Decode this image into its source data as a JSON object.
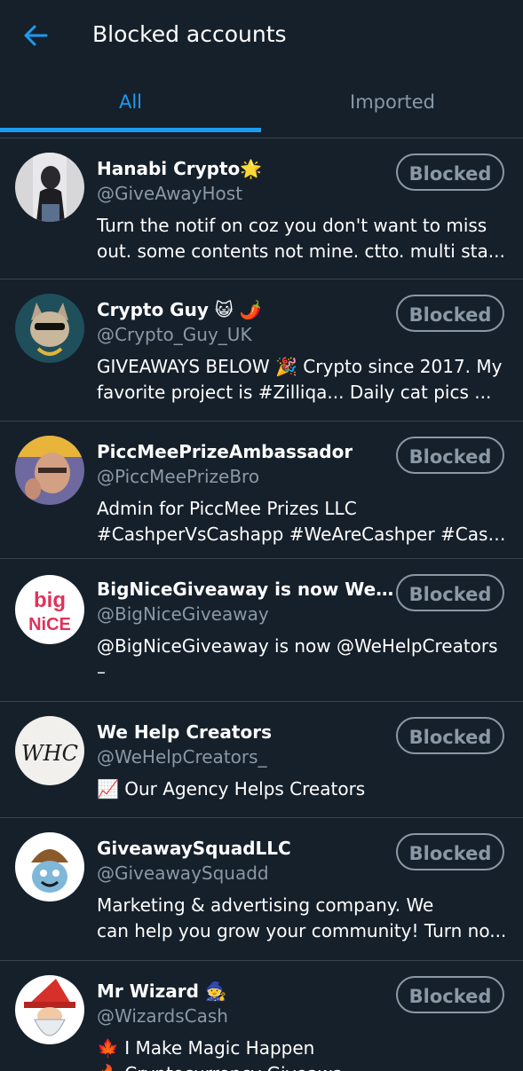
{
  "header": {
    "title": "Blocked accounts",
    "back_icon": "arrow-left-icon"
  },
  "tabs": [
    {
      "label": "All"
    },
    {
      "label": "Imported"
    }
  ],
  "colors": {
    "background": "#15202b",
    "accent": "#1d9bf0",
    "muted": "#8b98a5",
    "divider": "#38444d"
  },
  "accounts": [
    {
      "name": "Hanabi Crypto🌟",
      "handle": "@GiveAwayHost",
      "bio": [
        "Turn the notif on coz you don't want to miss",
        "out. some contents not mine. ctto. multi sta..."
      ],
      "button": "Blocked"
    },
    {
      "name": "Crypto Guy 😺 🌶️",
      "handle": "@Crypto_Guy_UK",
      "bio": [
        "GIVEAWAYS BELOW 🎉 Crypto since 2017. My",
        "favorite project is #Zilliqa... Daily cat pics ..."
      ],
      "button": "Blocked"
    },
    {
      "name": "PiccMeePrizeAmbassador",
      "handle": "@PiccMeePrizeBro",
      "bio": [
        "Admin for PiccMee Prizes LLC",
        "#CashperVsCashapp #WeAreCashper #Cash..."
      ],
      "button": "Blocked"
    },
    {
      "name": "BigNiceGiveaway is now WeHel...",
      "handle": "@BigNiceGiveaway",
      "bio": [
        "@BigNiceGiveaway is now @WeHelpCreators",
        "–"
      ],
      "button": "Blocked",
      "avatar_text": [
        "big",
        "NiCE"
      ]
    },
    {
      "name": "We Help Creators",
      "handle": "@WeHelpCreators_",
      "bio": [
        "📈 Our Agency Helps Creators"
      ],
      "button": "Blocked",
      "avatar_text": [
        "WHC"
      ]
    },
    {
      "name": "GiveawaySquadLLC",
      "handle": "@GiveawaySquadd",
      "bio": [
        "Marketing & advertising company. We",
        "can help you grow your community! Turn no..."
      ],
      "button": "Blocked"
    },
    {
      "name": "Mr Wizard 🧙",
      "handle": "@WizardsCash",
      "bio": [
        "🍁 I Make Magic Happen",
        "🔥 Cryptocurrency Giveawa..."
      ],
      "button": "Blocked"
    }
  ]
}
